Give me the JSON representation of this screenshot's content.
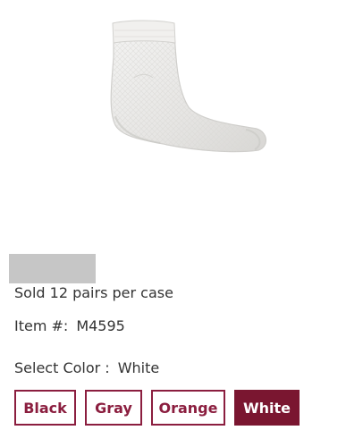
{
  "product": {
    "image_alt": "White ankle sock",
    "sold_text": "Sold 12 pairs per case",
    "item_label": "Item #:",
    "item_number": "M4595",
    "select_color_label": "Select Color :",
    "selected_color": "White"
  },
  "color_options": [
    {
      "label": "Black",
      "selected": false
    },
    {
      "label": "Gray",
      "selected": false
    },
    {
      "label": "Orange",
      "selected": false
    },
    {
      "label": "White",
      "selected": true
    }
  ],
  "colors": {
    "accent": "#8b1e3f",
    "selected_fill": "#7a1630",
    "placeholder": "#c6c6c6"
  }
}
